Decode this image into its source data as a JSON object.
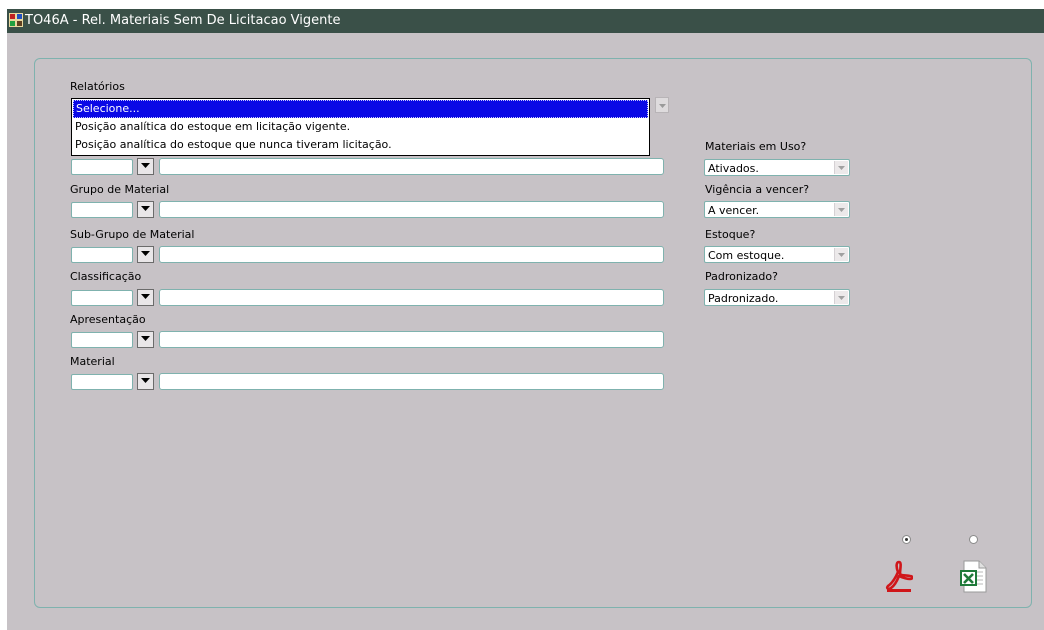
{
  "window": {
    "title": "TO46A - Rel. Materiais Sem De Licitacao Vigente",
    "icon": "oracle-forms-app-icon"
  },
  "relatorios": {
    "label": "Relatórios",
    "options": [
      "Selecione...",
      "Posição analítica do estoque em licitação vigente.",
      "Posição analítica do estoque que nunca tiveram licitação."
    ],
    "selected_index": 0
  },
  "fields": {
    "grupo": {
      "label": "Grupo de Material",
      "code": "",
      "description": ""
    },
    "subgrupo": {
      "label": "Sub-Grupo de Material",
      "code": "",
      "description": ""
    },
    "classificacao": {
      "label": "Classificação",
      "code": "",
      "description": ""
    },
    "apresentacao": {
      "label": "Apresentação",
      "code": "",
      "description": ""
    },
    "material": {
      "label": "Material",
      "code": "",
      "description": ""
    }
  },
  "filters": {
    "materiais_uso": {
      "label": "Materiais em Uso?",
      "value": "Ativados."
    },
    "vigencia": {
      "label": "Vigência a vencer?",
      "value": "A vencer."
    },
    "estoque": {
      "label": "Estoque?",
      "value": "Com estoque."
    },
    "padronizado": {
      "label": "Padronizado?",
      "value": "Padronizado."
    }
  },
  "output_format": {
    "options": [
      {
        "name": "pdf",
        "icon": "pdf-icon",
        "checked": true
      },
      {
        "name": "excel",
        "icon": "excel-icon",
        "checked": false
      }
    ]
  },
  "colors": {
    "titlebar": "#3a5048",
    "background": "#c7c2c6",
    "field_border": "#7fb2ae",
    "selection": "#0a09e6"
  }
}
